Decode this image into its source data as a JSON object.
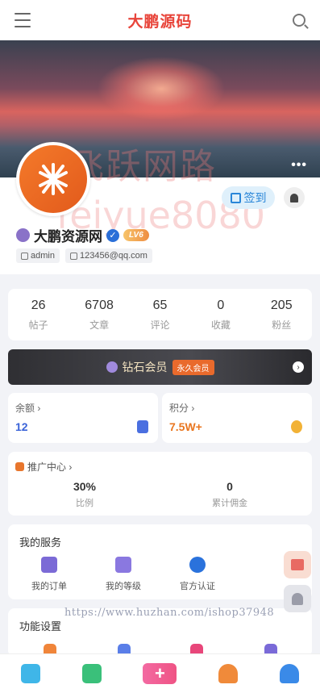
{
  "header": {
    "title": "大鹏源码"
  },
  "banner": {
    "more": "•••"
  },
  "watermarks": {
    "line1": "飞跃网路",
    "line2": "feiyue8080",
    "url": "https://www.huzhan.com/ishop37948"
  },
  "profile": {
    "checkin_label": "签到",
    "name": "大鹏资源网",
    "level_badge": "LV6",
    "username": "admin",
    "email": "123456@qq.com"
  },
  "stats": [
    {
      "value": "26",
      "label": "帖子"
    },
    {
      "value": "6708",
      "label": "文章"
    },
    {
      "value": "65",
      "label": "评论"
    },
    {
      "value": "0",
      "label": "收藏"
    },
    {
      "value": "205",
      "label": "粉丝"
    }
  ],
  "vip": {
    "label": "钻石会员",
    "badge": "永久会员"
  },
  "balance": {
    "title": "余额 ›",
    "value": "12",
    "value_color": "#3a63d8"
  },
  "points": {
    "title": "积分 ›",
    "value": "7.5W+",
    "value_color": "#e9761f"
  },
  "promo": {
    "title": "推广中心 ›",
    "ratio_value": "30%",
    "ratio_label": "比例",
    "commission_value": "0",
    "commission_label": "累计佣金"
  },
  "services": {
    "title": "我的服务",
    "items": [
      {
        "label": "我的订单",
        "icon": "order-icon"
      },
      {
        "label": "我的等级",
        "icon": "level-chart-icon"
      },
      {
        "label": "官方认证",
        "icon": "verified-icon"
      }
    ]
  },
  "settings": {
    "title": "功能设置"
  },
  "tabbar": {
    "items": [
      {
        "icon": "home-icon"
      },
      {
        "icon": "wallet-icon"
      },
      {
        "icon": "publish-plus-icon",
        "label": "+"
      },
      {
        "icon": "bell-icon"
      },
      {
        "icon": "user-icon"
      }
    ]
  }
}
